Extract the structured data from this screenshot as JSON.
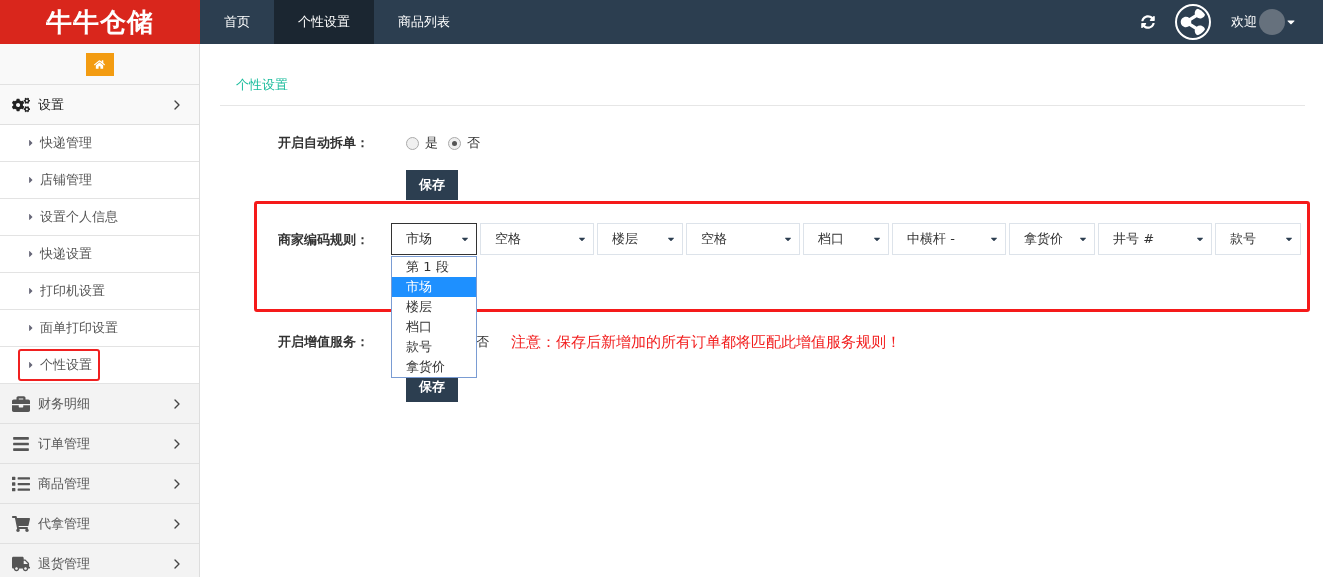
{
  "logo": {
    "text": "牛牛仓储"
  },
  "nav": {
    "tabs": [
      {
        "label": "首页",
        "selected": false
      },
      {
        "label": "个性设置",
        "selected": true
      },
      {
        "label": "商品列表",
        "selected": false
      }
    ],
    "user": {
      "greeting": "欢迎"
    }
  },
  "sidebar": {
    "groups": [
      {
        "label": "设置",
        "children": [
          {
            "label": "快递管理",
            "highlighted": false
          },
          {
            "label": "店铺管理",
            "highlighted": false
          },
          {
            "label": "设置个人信息",
            "highlighted": false
          },
          {
            "label": "快递设置",
            "highlighted": false
          },
          {
            "label": "打印机设置",
            "highlighted": false
          },
          {
            "label": "面单打印设置",
            "highlighted": false
          },
          {
            "label": "个性设置",
            "highlighted": true
          }
        ]
      },
      {
        "label": "财务明细"
      },
      {
        "label": "订单管理"
      },
      {
        "label": "商品管理"
      },
      {
        "label": "代拿管理"
      },
      {
        "label": "退货管理"
      }
    ]
  },
  "breadcrumb": "个性设置",
  "auto_split": {
    "label": "开启自动拆单：",
    "options": [
      {
        "label": "是",
        "checked": false
      },
      {
        "label": "否",
        "checked": true
      }
    ],
    "button": "保存"
  },
  "code_rule": {
    "label": "商家编码规则：",
    "highlighted": true,
    "selects": [
      {
        "kind": "field",
        "value": "市场",
        "open": true,
        "options": [
          {
            "label": "第 1 段",
            "selected": false
          },
          {
            "label": "市场",
            "selected": true
          },
          {
            "label": "楼层",
            "selected": false
          },
          {
            "label": "档口",
            "selected": false
          },
          {
            "label": "款号",
            "selected": false
          },
          {
            "label": "拿货价",
            "selected": false
          }
        ]
      },
      {
        "kind": "separator",
        "value": "空格",
        "open": false
      },
      {
        "kind": "field",
        "value": "楼层",
        "open": false
      },
      {
        "kind": "separator",
        "value": "空格",
        "open": false
      },
      {
        "kind": "field",
        "value": "档口",
        "open": false
      },
      {
        "kind": "separator",
        "value": "中横杆 -",
        "open": false
      },
      {
        "kind": "field",
        "value": "拿货价",
        "open": false
      },
      {
        "kind": "separator",
        "value": "井号 #",
        "open": false
      },
      {
        "kind": "field",
        "value": "款号",
        "open": false
      }
    ]
  },
  "value_added": {
    "label": "开启增值服务：",
    "visible_option": "否",
    "notice": "注意：保存后新增加的所有订单都将匹配此增值服务规则！",
    "button": "保存"
  }
}
